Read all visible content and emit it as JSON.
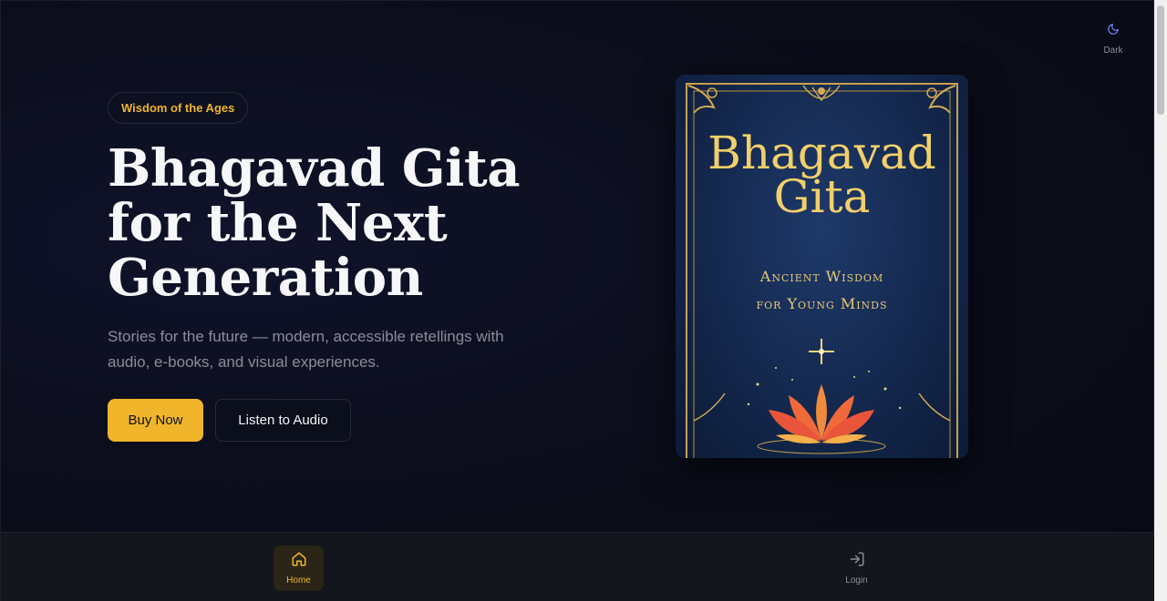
{
  "theme_toggle": {
    "icon": "moon-icon",
    "label": "Dark"
  },
  "hero": {
    "badge": "Wisdom of the Ages",
    "title": "Bhagavad Gita for the Next Generation",
    "subtitle": "Stories for the future — modern, accessible retellings with audio, e-books, and visual experiences.",
    "primary_button": "Buy Now",
    "secondary_button": "Listen to Audio"
  },
  "book_cover": {
    "title_line1": "Bhagavad",
    "title_line2": "Gita",
    "subtitle_line1": "Ancient Wisdom",
    "subtitle_line2": "for Young Minds"
  },
  "bottom_nav": {
    "items": [
      {
        "label": "Home",
        "icon": "home-icon",
        "active": true
      },
      {
        "label": "Login",
        "icon": "login-icon",
        "active": false
      }
    ]
  },
  "colors": {
    "accent": "#f0b52a",
    "background": "#0a0c18",
    "cover_gold": "#f2cf6a"
  }
}
